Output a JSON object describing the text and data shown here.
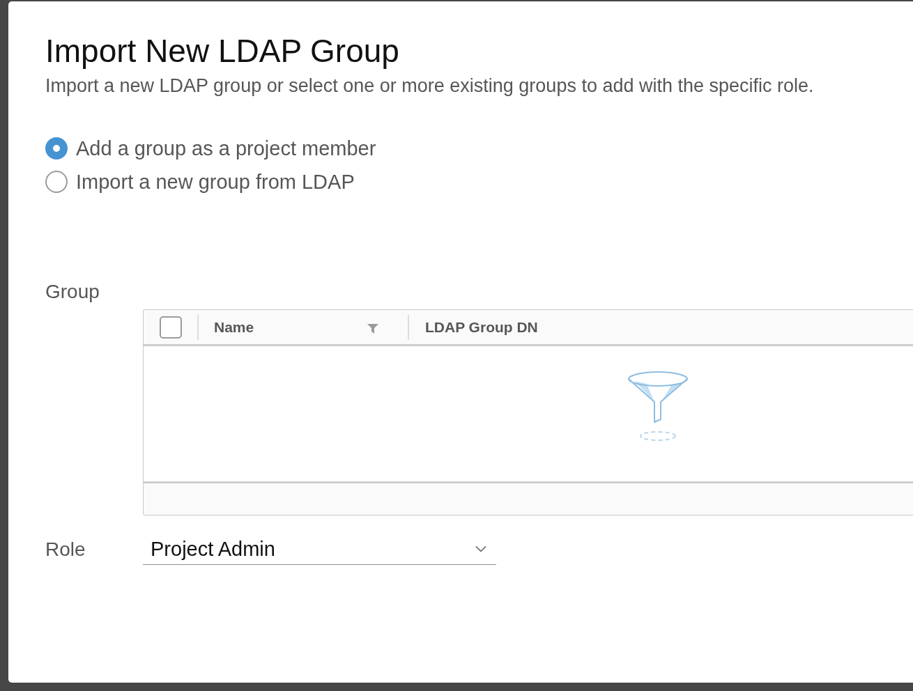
{
  "dialog": {
    "title": "Import New LDAP Group",
    "subtitle": "Import a new LDAP group or select one or more existing groups to add with the specific role."
  },
  "options": [
    {
      "label": "Add a group as a project member",
      "selected": true
    },
    {
      "label": "Import a new group from LDAP",
      "selected": false
    }
  ],
  "group": {
    "label": "Group",
    "table": {
      "select_all": {
        "checked": false
      },
      "columns": [
        {
          "label": "Name",
          "filter": true
        },
        {
          "label": "LDAP Group DN",
          "filter": false
        }
      ]
    }
  },
  "role": {
    "label": "Role",
    "value": "Project Admin"
  }
}
